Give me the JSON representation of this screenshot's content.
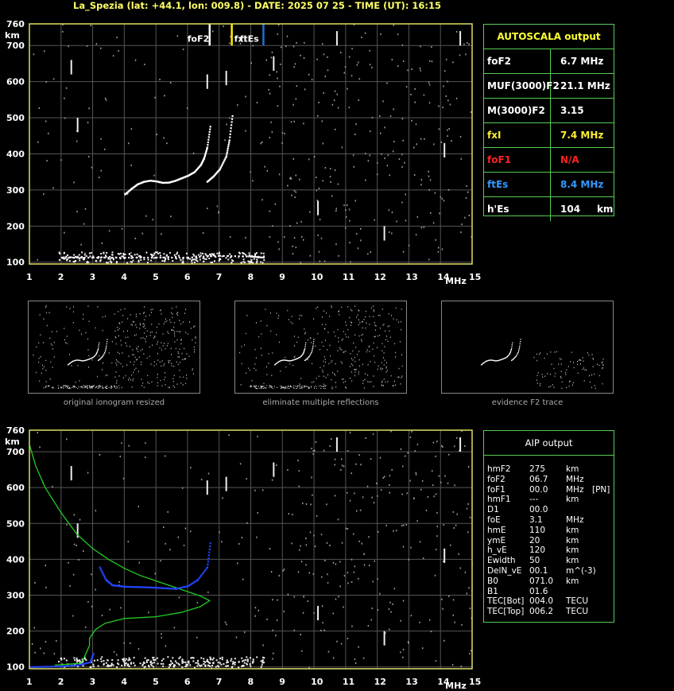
{
  "header": {
    "title": "La_Spezia (lat: +44.1, lon: 009.8) - DATE: 2025 07 25 - TIME (UT): 16:15"
  },
  "axis": {
    "y_unit": "km",
    "x_unit": "MHz",
    "y_ticks": [
      "760",
      "700",
      "600",
      "500",
      "400",
      "300",
      "200",
      "100"
    ],
    "x_ticks": [
      "1",
      "2",
      "3",
      "4",
      "5",
      "6",
      "7",
      "8",
      "9",
      "10",
      "11",
      "12",
      "13",
      "14",
      "15"
    ]
  },
  "markers": {
    "foF2": "foF2",
    "fxI": "fxI",
    "ftEs": "ftEs"
  },
  "colors": {
    "axis": "#dddd66",
    "grid": "#555555",
    "trace": "#ffffff",
    "fof2_line": "#ffffff",
    "fxi_line": "#ffee00",
    "ftes_line": "#1e6fd6",
    "profile": "#22cc22",
    "aip_trace": "#2244ff",
    "panel_border": "#55cc55"
  },
  "autoscala": {
    "title": "AUTOSCALA output",
    "rows": [
      {
        "label": "foF2",
        "value": "6.7 MHz",
        "color": "#ffffff"
      },
      {
        "label": "MUF(3000)F2",
        "value": "21.1 MHz",
        "color": "#ffffff"
      },
      {
        "label": "M(3000)F2",
        "value": "3.15",
        "color": "#ffffff"
      },
      {
        "label": "fxI",
        "value": "7.4 MHz",
        "color": "#ffee33"
      },
      {
        "label": "foF1",
        "value": "N/A",
        "color": "#ff2222"
      },
      {
        "label": "ftEs",
        "value": "8.4 MHz",
        "color": "#3399ff"
      },
      {
        "label": "h'Es",
        "value": "104     km",
        "color": "#ffffff"
      }
    ]
  },
  "thumbnails": [
    {
      "caption": "original ionogram resized"
    },
    {
      "caption": "eliminate multiple reflections"
    },
    {
      "caption": "evidence F2 trace"
    }
  ],
  "aip": {
    "title": "AIP output",
    "rows": [
      {
        "name": "hmF2",
        "value": "275",
        "unit": "km",
        "extra": ""
      },
      {
        "name": "foF2",
        "value": "06.7",
        "unit": "MHz",
        "extra": ""
      },
      {
        "name": "foF1",
        "value": "00.0",
        "unit": "MHz",
        "extra": "[PN]"
      },
      {
        "name": "hmF1",
        "value": "---",
        "unit": "km",
        "extra": ""
      },
      {
        "name": "D1",
        "value": "00.0",
        "unit": "",
        "extra": ""
      },
      {
        "name": "foE",
        "value": "3.1",
        "unit": "MHz",
        "extra": ""
      },
      {
        "name": "hmE",
        "value": "110",
        "unit": "km",
        "extra": ""
      },
      {
        "name": "ymE",
        "value": "20",
        "unit": "km",
        "extra": ""
      },
      {
        "name": "h_vE",
        "value": "120",
        "unit": "km",
        "extra": ""
      },
      {
        "name": "Ewidth",
        "value": "50",
        "unit": "km",
        "extra": ""
      },
      {
        "name": "DelN_vE",
        "value": "00.1",
        "unit": "m^(-3)",
        "extra": ""
      },
      {
        "name": "B0",
        "value": "071.0",
        "unit": "km",
        "extra": ""
      },
      {
        "name": "B1",
        "value": "01.6",
        "unit": "",
        "extra": ""
      },
      {
        "name": "TEC[Bot]",
        "value": "004.0",
        "unit": "TECU",
        "extra": ""
      },
      {
        "name": "TEC[Top]",
        "value": "006.2",
        "unit": "TECU",
        "extra": ""
      }
    ]
  },
  "chart_data": [
    {
      "type": "scatter",
      "title": "",
      "xlabel": "MHz",
      "ylabel": "km",
      "xlim": [
        1,
        15
      ],
      "ylim": [
        95,
        760
      ],
      "grid": true,
      "series": [
        {
          "name": "F2 trace",
          "x": [
            4.0,
            4.2,
            4.4,
            4.6,
            4.8,
            5.0,
            5.2,
            5.4,
            5.6,
            5.8,
            6.0,
            6.2,
            6.4,
            6.5,
            6.6,
            6.7
          ],
          "y": [
            290,
            305,
            318,
            325,
            328,
            326,
            322,
            323,
            328,
            335,
            342,
            352,
            372,
            390,
            420,
            480
          ]
        },
        {
          "name": "extraordinary trace",
          "x": [
            6.6,
            6.8,
            7.0,
            7.2,
            7.3,
            7.4
          ],
          "y": [
            325,
            340,
            360,
            395,
            440,
            510
          ]
        },
        {
          "name": "Es trace",
          "x": [
            2.0,
            3.0,
            4.0,
            5.0,
            6.0,
            7.0,
            8.0,
            8.4
          ],
          "y": [
            115,
            115,
            115,
            115,
            115,
            120,
            118,
            115
          ]
        }
      ],
      "vertical_markers": [
        {
          "name": "foF2",
          "x": 6.7
        },
        {
          "name": "fxI",
          "x": 7.4
        },
        {
          "name": "ftEs",
          "x": 8.4
        }
      ]
    },
    {
      "type": "line",
      "title": "",
      "xlabel": "MHz",
      "ylabel": "km",
      "xlim": [
        1,
        15
      ],
      "ylim": [
        95,
        760
      ],
      "grid": true,
      "series": [
        {
          "name": "electron density profile",
          "x": [
            1.0,
            1.2,
            1.5,
            2.0,
            2.5,
            3.0,
            3.5,
            4.0,
            4.5,
            5.0,
            5.5,
            6.0,
            6.4,
            6.7,
            6.4,
            5.8,
            5.0,
            4.0,
            3.4,
            3.1,
            2.9,
            2.9,
            2.8,
            2.7,
            2.6,
            1.8
          ],
          "y": [
            720,
            660,
            600,
            530,
            470,
            430,
            400,
            375,
            355,
            340,
            325,
            310,
            298,
            285,
            268,
            252,
            240,
            235,
            222,
            205,
            180,
            160,
            140,
            120,
            110,
            105
          ]
        },
        {
          "name": "AIP trace",
          "x": [
            3.2,
            3.4,
            3.6,
            3.8,
            4.0,
            4.4,
            4.8,
            5.2,
            5.6,
            6.0,
            6.3,
            6.6,
            6.7
          ],
          "y": [
            380,
            345,
            330,
            328,
            326,
            325,
            324,
            322,
            320,
            328,
            345,
            380,
            450
          ]
        },
        {
          "name": "AIP E trace",
          "x": [
            1.0,
            1.5,
            2.0,
            2.5,
            2.9,
            3.0
          ],
          "y": [
            102,
            103,
            104,
            107,
            115,
            140
          ]
        }
      ]
    }
  ]
}
